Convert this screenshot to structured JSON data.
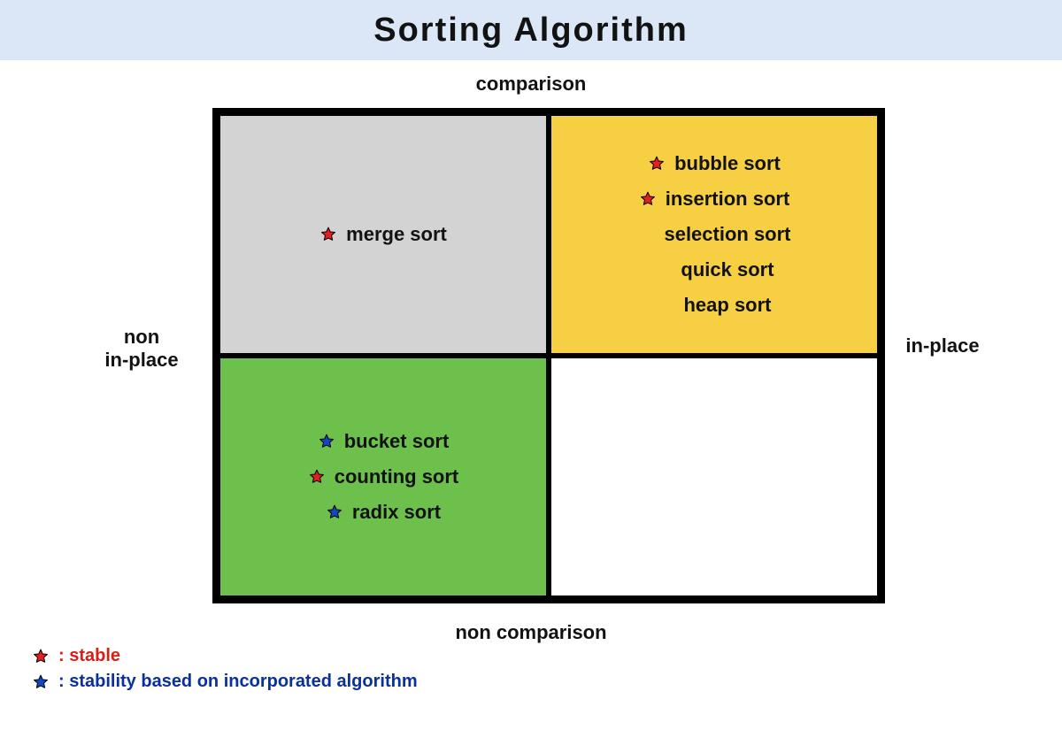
{
  "title": "Sorting Algorithm",
  "axes": {
    "top": "comparison",
    "bottom": "non comparison",
    "left": "non\nin-place",
    "right": "in-place"
  },
  "colors": {
    "star_red": "#e51f1f",
    "star_blue": "#1047c3",
    "quad_tl": "#d3d3d3",
    "quad_tr": "#f7cf43",
    "quad_bl": "#6dc04c",
    "quad_br": "#ffffff",
    "title_bg": "#dbe7f6"
  },
  "quadrants": {
    "tl": {
      "comparison": true,
      "in_place": false,
      "items": [
        {
          "label": "merge sort",
          "star": "red"
        }
      ]
    },
    "tr": {
      "comparison": true,
      "in_place": true,
      "items": [
        {
          "label": "bubble sort",
          "star": "red"
        },
        {
          "label": "insertion sort",
          "star": "red"
        },
        {
          "label": "selection sort",
          "star": null
        },
        {
          "label": "quick sort",
          "star": null
        },
        {
          "label": "heap sort",
          "star": null
        }
      ]
    },
    "bl": {
      "comparison": false,
      "in_place": false,
      "items": [
        {
          "label": "bucket sort",
          "star": "blue"
        },
        {
          "label": "counting sort",
          "star": "red"
        },
        {
          "label": "radix sort",
          "star": "blue"
        }
      ]
    },
    "br": {
      "comparison": false,
      "in_place": true,
      "items": []
    }
  },
  "legend": {
    "red": ": stable",
    "blue": ": stability based on incorporated algorithm"
  }
}
